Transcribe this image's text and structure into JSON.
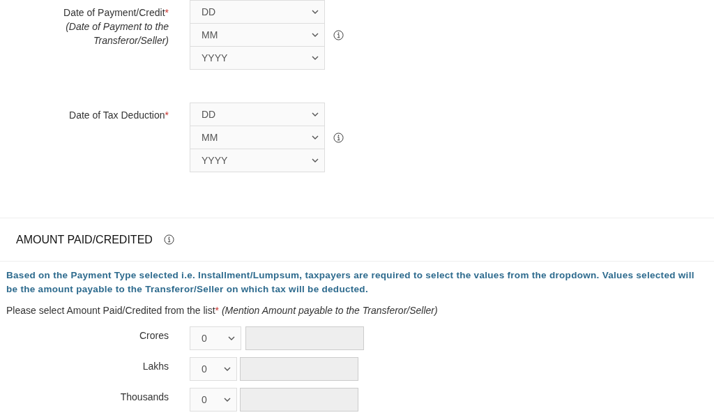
{
  "date_fields": [
    {
      "label": "Date of Payment/Credit",
      "required_mark": "*",
      "note": "(Date of Payment to the Transferor/Seller)",
      "selects": [
        {
          "value": "DD"
        },
        {
          "value": "MM"
        },
        {
          "value": "YYYY"
        }
      ]
    },
    {
      "label": "Date of Tax Deduction",
      "required_mark": "*",
      "selects": [
        {
          "value": "DD"
        },
        {
          "value": "MM"
        },
        {
          "value": "YYYY"
        }
      ]
    }
  ],
  "amount_section": {
    "heading": "AMOUNT PAID/CREDITED",
    "info": "Based on the Payment Type selected i.e. Installment/Lumpsum, taxpayers are required to select the values from the dropdown. Values selected will be the amount payable to the Transferor/Seller on which tax will be deducted.",
    "prompt": "Please select Amount Paid/Credited from the list",
    "prompt_mark": "*",
    "prompt_note": "(Mention Amount payable to the Transferor/Seller)",
    "rows": [
      {
        "label": "Crores",
        "select": "0",
        "disabled": true
      },
      {
        "label": "Lakhs",
        "select": "0",
        "disabled": true
      },
      {
        "label": "Thousands",
        "select": "0",
        "disabled": true
      }
    ]
  }
}
